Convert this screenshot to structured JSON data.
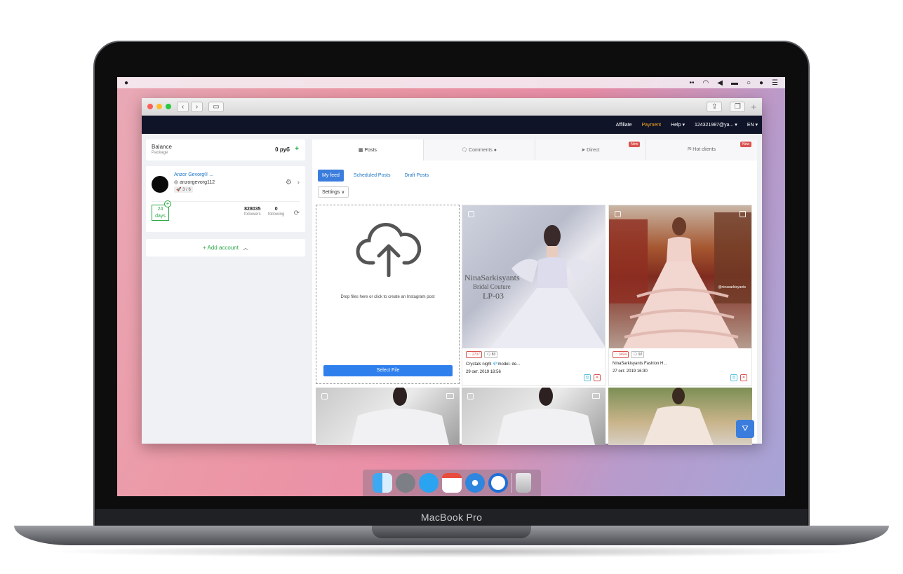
{
  "device": {
    "label": "MacBook Pro"
  },
  "nav": {
    "affiliate": "Affiliate",
    "payment": "Payment",
    "help": "Help ▾",
    "user": "124321987@ya... ▾",
    "lang": "EN ▾"
  },
  "balance": {
    "title": "Balance",
    "subtitle": "Package",
    "amount": "0 руб",
    "add": "+"
  },
  "account": {
    "name": "Anzor Gevorg® ...",
    "handle": "anzorgevorg112",
    "badge": "🚀 3 / 6",
    "days_value": "24",
    "days_label": "days",
    "followers_value": "828035",
    "followers_label": "followers",
    "following_value": "0",
    "following_label": "following"
  },
  "add_account": {
    "label": "+ Add account"
  },
  "tabs": [
    {
      "label": "▦ Posts"
    },
    {
      "label": "🗨 Comments ●"
    },
    {
      "label": "➤ Direct",
      "badge": "New"
    },
    {
      "label": "⛿ Hot clients",
      "badge": "New"
    }
  ],
  "subtabs": {
    "my_feed": "My feed",
    "scheduled": "Scheduled Posts",
    "draft": "Draft Posts"
  },
  "settings": {
    "label": "Settings ∨"
  },
  "upload": {
    "text": "Drop files here or click to create an Instagram post",
    "button": "Select File"
  },
  "posts": [
    {
      "likes": "♡ 2737",
      "comments": "🗨 83",
      "caption": "Crystals night 💎model- de...",
      "date": "29 окт. 2019 18:56",
      "overlay": [
        "NinaSarkisyants",
        "Bridal Couture",
        "LP-03"
      ]
    },
    {
      "likes": "♡ 3494",
      "comments": "🗨 92",
      "caption": "NinaSarkisyants Fashion H...",
      "date": "27 окт. 2019 16:30",
      "overlay": [
        "@ninasarkisyants"
      ]
    }
  ],
  "colors": {
    "accent": "#3b7ddd",
    "nav_bg": "#0f1429",
    "payment": "#f5a623",
    "success": "#28a745",
    "danger": "#d9534f"
  }
}
